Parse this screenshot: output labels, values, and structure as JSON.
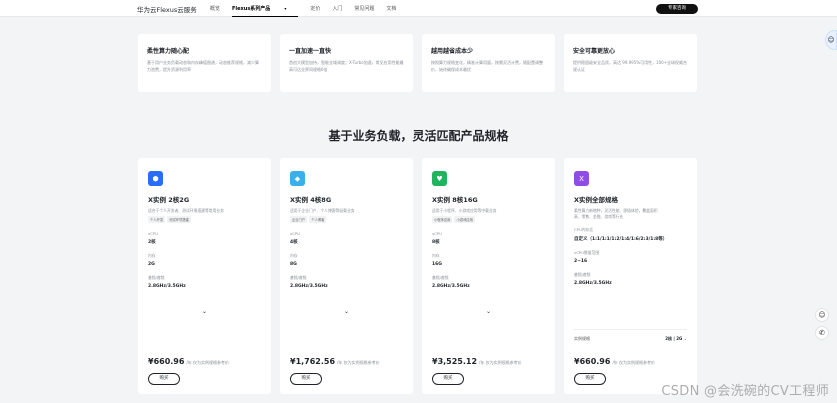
{
  "topbar": {
    "brand": "华为云Flexus云服务",
    "nav": [
      "概览",
      "Flexus系列产品",
      "定价",
      "入门",
      "常见问题",
      "文档"
    ],
    "active_index": 1,
    "consult": "专家咨询"
  },
  "features": [
    {
      "title": "柔性算力随心配",
      "desc": "基于用户业务负载动态和内存峰值图谱，动态推荐规格，减少算力浪费，提升资源利用率"
    },
    {
      "title": "一直加速一直快",
      "desc": "首创大模型加持，智能全域调度；X-Turbo加速，常见应用性能最高可达业界同规格6倍"
    },
    {
      "title": "越用越省成本少",
      "desc": "按照算力规格变化，精准计算用量，按需灵活计费，随配置调整价，始终确保成本最优"
    },
    {
      "title": "安全可靠更放心",
      "desc": "提供稳固级安全品质，高达 99.995%可用性，100+全球权威合规认证"
    }
  ],
  "section_title": "基于业务负载，灵活匹配产品规格",
  "cards": [
    {
      "icon_name": "shield-icon",
      "icon_glyph": "⬢",
      "color": "#2b6cf6",
      "title": "X实例 2核2G",
      "desc": "适合于个人开发者、测试环境搭建等常用业务",
      "tags": [
        "个人开发",
        "测试环境搭建"
      ],
      "specs": [
        {
          "k": "vCPU",
          "v": "2核"
        },
        {
          "k": "内存",
          "v": "2G"
        },
        {
          "k": "基频/睿频",
          "v": "2.8GHz/3.5GHz"
        }
      ],
      "price": "¥660.96",
      "unit": "/年 仅为实例规格参考价",
      "buy": "购买"
    },
    {
      "icon_name": "diamond-icon",
      "icon_glyph": "◆",
      "color": "#3ab0ea",
      "title": "X实例 4核8G",
      "desc": "适用于企业门户、个人博客等轻载业务",
      "tags": [
        "企业门户",
        "个人博客"
      ],
      "specs": [
        {
          "k": "vCPU",
          "v": "4核"
        },
        {
          "k": "内存",
          "v": "8G"
        },
        {
          "k": "基频/睿频",
          "v": "2.8GHz/3.5GHz"
        }
      ],
      "price": "¥1,762.56",
      "unit": "/年 仅为实例规格参考价",
      "buy": "购买"
    },
    {
      "icon_name": "heart-icon",
      "icon_glyph": "♥",
      "color": "#22b35e",
      "title": "X实例 8核16G",
      "desc": "适用于小程序、小游戏应用等中载业务",
      "tags": [
        "小程序应用",
        "小游戏应用"
      ],
      "specs": [
        {
          "k": "vCPU",
          "v": "8核"
        },
        {
          "k": "内存",
          "v": "16G"
        },
        {
          "k": "基频/睿频",
          "v": "2.8GHz/3.5GHz"
        }
      ],
      "price": "¥3,525.12",
      "unit": "/年 仅为实例规格参考价",
      "buy": "购买"
    },
    {
      "icon_name": "x-icon",
      "icon_glyph": "X",
      "color": "#8e4ee6",
      "title": "X实例全部规格",
      "desc": "柔性算力新物种，灵活性能、即插体验，覆盖面积",
      "desc2": "高、零售、金融、游戏等行业",
      "specs": [
        {
          "k": "CPU内存比",
          "v": "自定义（1:1/1:1/1:2/1:4/1:6/2:3/1:8等）"
        },
        {
          "k": "vCPU数量范围",
          "v": "2~16"
        },
        {
          "k": "基频/睿频",
          "v": "2.8GHz/3.5GHz"
        }
      ],
      "select_label": "实例规格",
      "select_value": "2核 | 2G",
      "price": "¥660.96",
      "unit": "/年 仅为实例规格参考价",
      "buy": "购买"
    }
  ],
  "watermark": "CSDN @会洗碗的CV工程师"
}
